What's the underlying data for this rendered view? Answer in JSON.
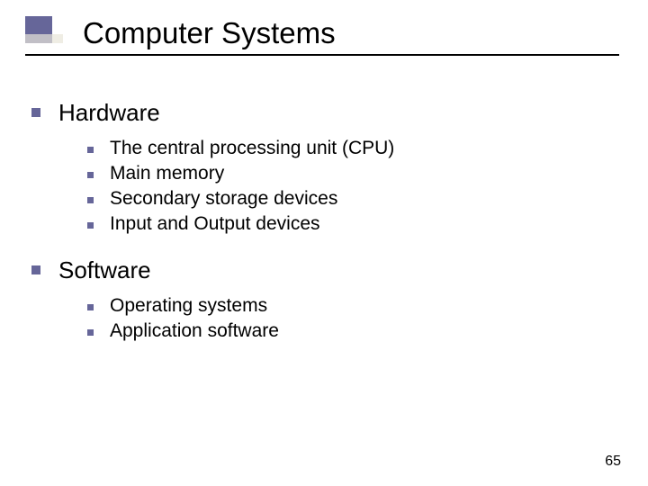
{
  "title": "Computer Systems",
  "sections": [
    {
      "heading": "Hardware",
      "items": [
        "The central processing unit (CPU)",
        "Main memory",
        "Secondary storage devices",
        "Input and Output devices"
      ]
    },
    {
      "heading": "Software",
      "items": [
        "Operating systems",
        "Application software"
      ]
    }
  ],
  "pageNumber": "65"
}
